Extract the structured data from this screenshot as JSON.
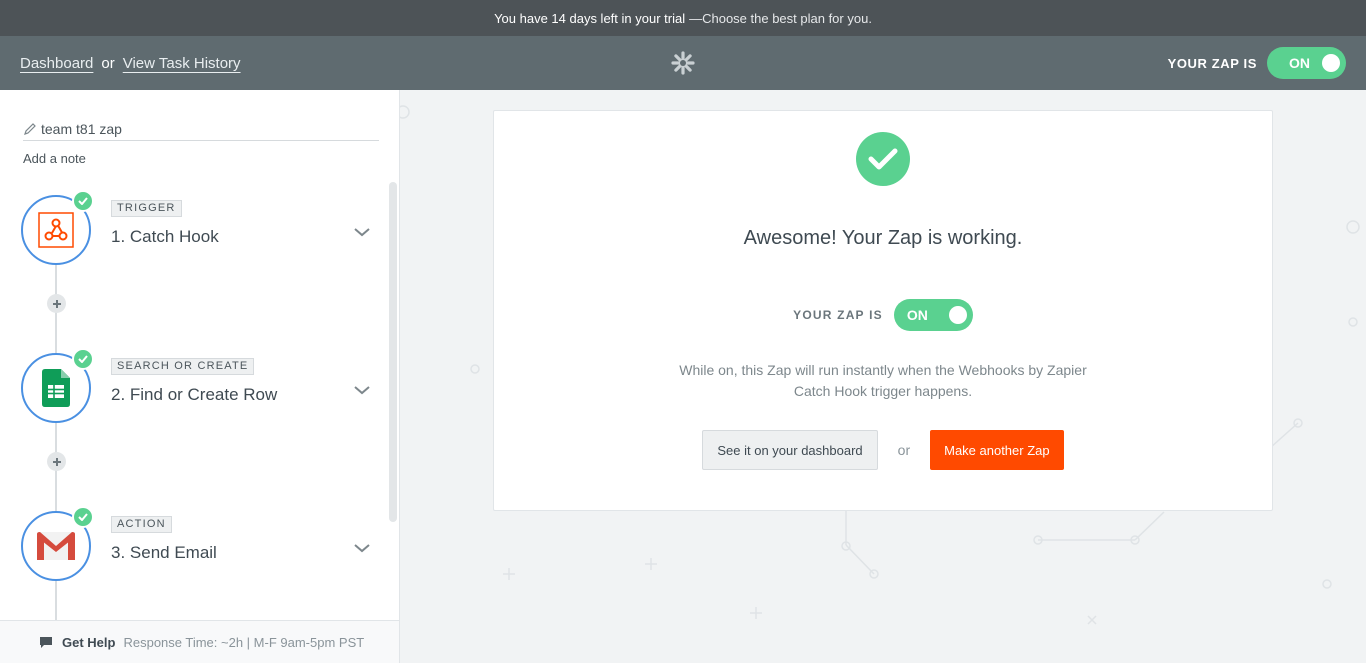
{
  "trial_bar": {
    "main": "You have 14 days left in your trial",
    "sub": "—Choose the best plan for you."
  },
  "topbar": {
    "dashboard_link": "Dashboard",
    "or": "or",
    "history_link": "View Task History",
    "logo_icon": "zapier-asterisk-icon",
    "zap_status_label": "YOUR ZAP IS",
    "toggle_label": "ON"
  },
  "sidebar": {
    "zap_name": "team t81 zap",
    "add_note": "Add a note",
    "steps": [
      {
        "badge": "TRIGGER",
        "title": "1. Catch Hook",
        "icon": "webhook-icon"
      },
      {
        "badge": "SEARCH OR CREATE",
        "title": "2. Find or Create Row",
        "icon": "google-sheets-icon"
      },
      {
        "badge": "ACTION",
        "title": "3. Send Email",
        "icon": "gmail-icon"
      }
    ]
  },
  "help": {
    "label": "Get Help",
    "response": "Response Time: ~2h  |  M-F 9am-5pm PST"
  },
  "card": {
    "headline": "Awesome! Your Zap is working.",
    "status_label": "YOUR ZAP IS",
    "toggle_label": "ON",
    "description": "While on, this Zap will run instantly when the Webhooks by Zapier Catch Hook trigger happens.",
    "dashboard_button": "See it on your dashboard",
    "or": "or",
    "make_button": "Make another Zap"
  },
  "colors": {
    "accent_green": "#5ad190",
    "accent_orange": "#ff4a00",
    "step_border": "#4a90e2"
  }
}
